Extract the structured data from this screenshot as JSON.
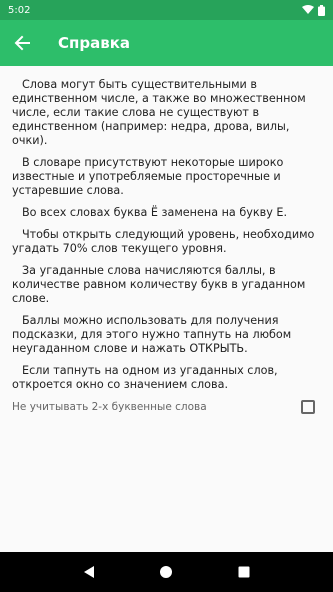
{
  "status": {
    "time": "5:02"
  },
  "appbar": {
    "title": "Справка"
  },
  "paragraphs": [
    "Слова могут быть существительными в единственном числе, а также во множественном числе, если такие слова не существуют в единственном (например: недра, дрова, вилы, очки).",
    "В словаре присутствуют некоторые широко известные и употребляемые просторечные и устаревшие слова.",
    "Во всех словах буква Ё заменена на букву Е.",
    "Чтобы открыть следующий уровень, необходимо угадать 70% слов текущего уровня.",
    "За угаданные слова начисляются баллы, в количестве равном количеству букв в угаданном слове.",
    "Баллы можно использовать для получения подсказки, для этого нужно тапнуть на любом неугаданном слове и нажать ОТКРЫТЬ.",
    "Если тапнуть на одном из угаданных слов, откроется окно со значением слова."
  ],
  "option": {
    "label": "Не учитывать 2-х буквенные слова",
    "checked": false
  },
  "colors": {
    "status_bar": "#27a35a",
    "app_bar": "#2dbe6a"
  },
  "icons": {
    "back": "arrow-back-icon",
    "wifi": "wifi-icon",
    "battery": "battery-icon",
    "nav_back": "triangle-back-icon",
    "nav_home": "circle-home-icon",
    "nav_recents": "square-recents-icon"
  }
}
